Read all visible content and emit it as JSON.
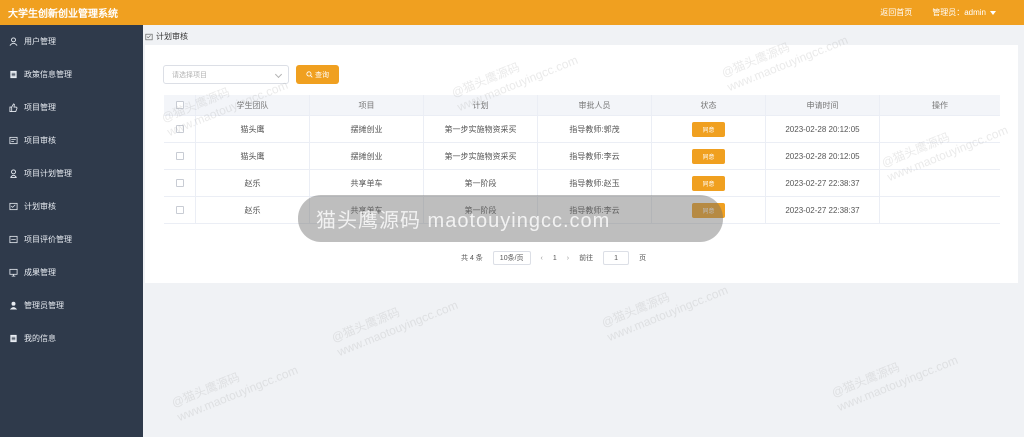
{
  "header": {
    "title": "大学生创新创业管理系统",
    "home_link": "返回首页",
    "admin_label": "管理员：admin"
  },
  "sidebar": {
    "items": [
      {
        "label": "用户管理",
        "icon": "user-icon"
      },
      {
        "label": "政策信息管理",
        "icon": "document-icon"
      },
      {
        "label": "项目管理",
        "icon": "thumb-icon"
      },
      {
        "label": "项目审核",
        "icon": "audit-icon"
      },
      {
        "label": "项目计划管理",
        "icon": "user-plan-icon"
      },
      {
        "label": "计划审核",
        "icon": "plan-audit-icon"
      },
      {
        "label": "项目评价管理",
        "icon": "evaluation-icon"
      },
      {
        "label": "成果管理",
        "icon": "monitor-icon"
      },
      {
        "label": "管理员管理",
        "icon": "admin-icon"
      },
      {
        "label": "我的信息",
        "icon": "info-icon"
      }
    ]
  },
  "breadcrumb": {
    "label": "计划审核"
  },
  "filter": {
    "placeholder": "请选择项目",
    "query_label": "查询"
  },
  "table": {
    "columns": [
      "学生团队",
      "项目",
      "计划",
      "审批人员",
      "状态",
      "申请时间",
      "操作"
    ],
    "rows": [
      {
        "team": "猫头鹰",
        "project": "摆摊创业",
        "plan": "第一步实施物资采买",
        "approver": "指导教师:郭茂",
        "status": "同意",
        "time": "2023-02-28 20:12:05",
        "action": ""
      },
      {
        "team": "猫头鹰",
        "project": "摆摊创业",
        "plan": "第一步实施物资采买",
        "approver": "指导教师:李云",
        "status": "同意",
        "time": "2023-02-28 20:12:05",
        "action": ""
      },
      {
        "team": "赵乐",
        "project": "共享单车",
        "plan": "第一阶段",
        "approver": "指导教师:赵玉",
        "status": "同意",
        "time": "2023-02-27 22:38:37",
        "action": ""
      },
      {
        "team": "赵乐",
        "project": "共享单车",
        "plan": "第一阶段",
        "approver": "指导教师:李云",
        "status": "同意",
        "time": "2023-02-27 22:38:37",
        "action": ""
      }
    ]
  },
  "pagination": {
    "total": "共 4 条",
    "page_size": "10条/页",
    "prev": "‹",
    "current": "1",
    "next": "›",
    "goto_label": "前往",
    "goto_value": "1",
    "page_unit": "页"
  },
  "overlay": {
    "text": "猫头鹰源码 maotouyingcc.com"
  },
  "watermark": {
    "brand": "@猫头鹰源码",
    "url": "www.maotouyingcc.com"
  },
  "colors": {
    "accent": "#f0a020",
    "sidebar": "#2f3a4b"
  }
}
